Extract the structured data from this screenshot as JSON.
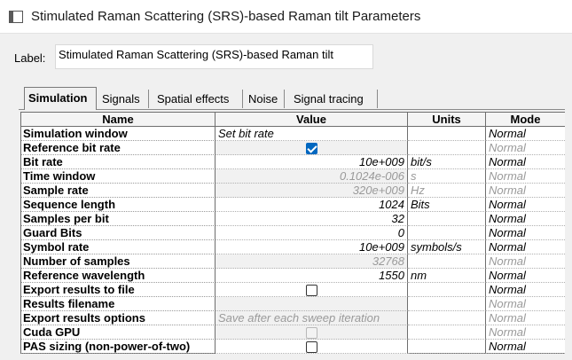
{
  "window": {
    "title": "Stimulated Raman Scattering (SRS)-based Raman tilt Parameters"
  },
  "label": {
    "caption": "Label:",
    "value": "Stimulated Raman Scattering (SRS)-based Raman tilt"
  },
  "tabs": [
    "Simulation",
    "Signals",
    "Spatial effects",
    "Noise",
    "Signal tracing"
  ],
  "active_tab": "Simulation",
  "grid": {
    "headers": {
      "name": "Name",
      "value": "Value",
      "units": "Units",
      "mode": "Mode"
    },
    "rows": [
      {
        "name": "Simulation window",
        "value": "Set bit rate",
        "units": "",
        "mode": "Normal",
        "kind": "text",
        "enabled": true
      },
      {
        "name": "Reference bit rate",
        "value": "",
        "units": "",
        "mode": "Normal",
        "kind": "checkbox",
        "checked": true,
        "enabled": false
      },
      {
        "name": "Bit rate",
        "value": "10e+009",
        "units": "bit/s",
        "mode": "Normal",
        "kind": "number",
        "enabled": true
      },
      {
        "name": "Time window",
        "value": "0.1024e-006",
        "units": "s",
        "mode": "Normal",
        "kind": "number",
        "enabled": false
      },
      {
        "name": "Sample rate",
        "value": "320e+009",
        "units": "Hz",
        "mode": "Normal",
        "kind": "number",
        "enabled": false
      },
      {
        "name": "Sequence length",
        "value": "1024",
        "units": "Bits",
        "mode": "Normal",
        "kind": "number",
        "enabled": true
      },
      {
        "name": "Samples per bit",
        "value": "32",
        "units": "",
        "mode": "Normal",
        "kind": "number",
        "enabled": true
      },
      {
        "name": "Guard Bits",
        "value": "0",
        "units": "",
        "mode": "Normal",
        "kind": "number",
        "enabled": true
      },
      {
        "name": "Symbol rate",
        "value": "10e+009",
        "units": "symbols/s",
        "mode": "Normal",
        "kind": "number",
        "enabled": true
      },
      {
        "name": "Number of samples",
        "value": "32768",
        "units": "",
        "mode": "Normal",
        "kind": "number",
        "enabled": false
      },
      {
        "name": "Reference wavelength",
        "value": "1550",
        "units": "nm",
        "mode": "Normal",
        "kind": "number",
        "enabled": true
      },
      {
        "name": "Export results to file",
        "value": "",
        "units": "",
        "mode": "Normal",
        "kind": "checkbox",
        "checked": false,
        "enabled": true
      },
      {
        "name": "Results filename",
        "value": "",
        "units": "",
        "mode": "Normal",
        "kind": "text",
        "enabled": false
      },
      {
        "name": "Export results options",
        "value": "Save after each sweep iteration",
        "units": "",
        "mode": "Normal",
        "kind": "text",
        "enabled": false
      },
      {
        "name": "Cuda GPU",
        "value": "",
        "units": "",
        "mode": "Normal",
        "kind": "checkbox",
        "checked": false,
        "enabled": false
      },
      {
        "name": "PAS sizing (non-power-of-two)",
        "value": "",
        "units": "",
        "mode": "Normal",
        "kind": "checkbox",
        "checked": false,
        "enabled": true
      }
    ]
  },
  "colors": {
    "accent": "#0067c0",
    "disabled_text": "#9a9a9a",
    "grid_border": "#6e6e6e"
  }
}
